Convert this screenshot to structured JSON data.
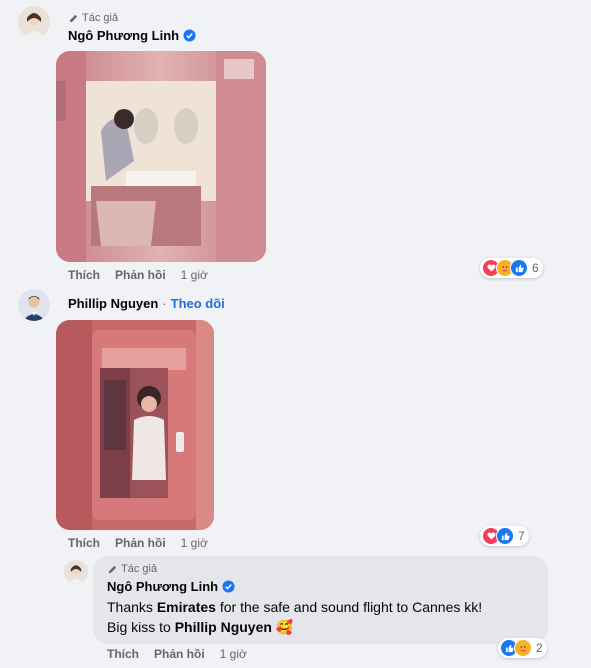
{
  "comments": [
    {
      "author_badge": "Tác giả",
      "author_name": "Ngô Phương Linh",
      "verified": true,
      "actions": {
        "like": "Thích",
        "reply": "Phản hồi",
        "time": "1 giờ"
      },
      "reactions": {
        "icons": [
          "heart-icon",
          "care-icon",
          "like-icon"
        ],
        "count": "6"
      }
    },
    {
      "author_name": "Phillip Nguyen",
      "follow_label": "Theo dõi",
      "actions": {
        "like": "Thích",
        "reply": "Phản hồi",
        "time": "1 giờ"
      },
      "reactions": {
        "icons": [
          "heart-icon",
          "like-icon"
        ],
        "count": "7"
      }
    }
  ],
  "reply": {
    "author_badge": "Tác giả",
    "author_name": "Ngô Phương Linh",
    "verified": true,
    "text_parts": {
      "p1": "Thanks ",
      "mention1": "Emirates",
      "p2": " for the safe and sound flight to Cannes kk!",
      "p3": "Big kiss to ",
      "mention2": "Phillip Nguyen",
      "emoji": "🥰"
    },
    "actions": {
      "like": "Thích",
      "reply": "Phản hồi",
      "time": "1 giờ"
    },
    "reactions": {
      "icons": [
        "like-icon",
        "care-icon"
      ],
      "count": "2"
    }
  },
  "colors": {
    "background": "#f0f2f5",
    "link_blue": "#216fdb",
    "bubble": "#e4e6eb",
    "like_blue": "#1877f2",
    "heart_red": "#f33e58"
  }
}
